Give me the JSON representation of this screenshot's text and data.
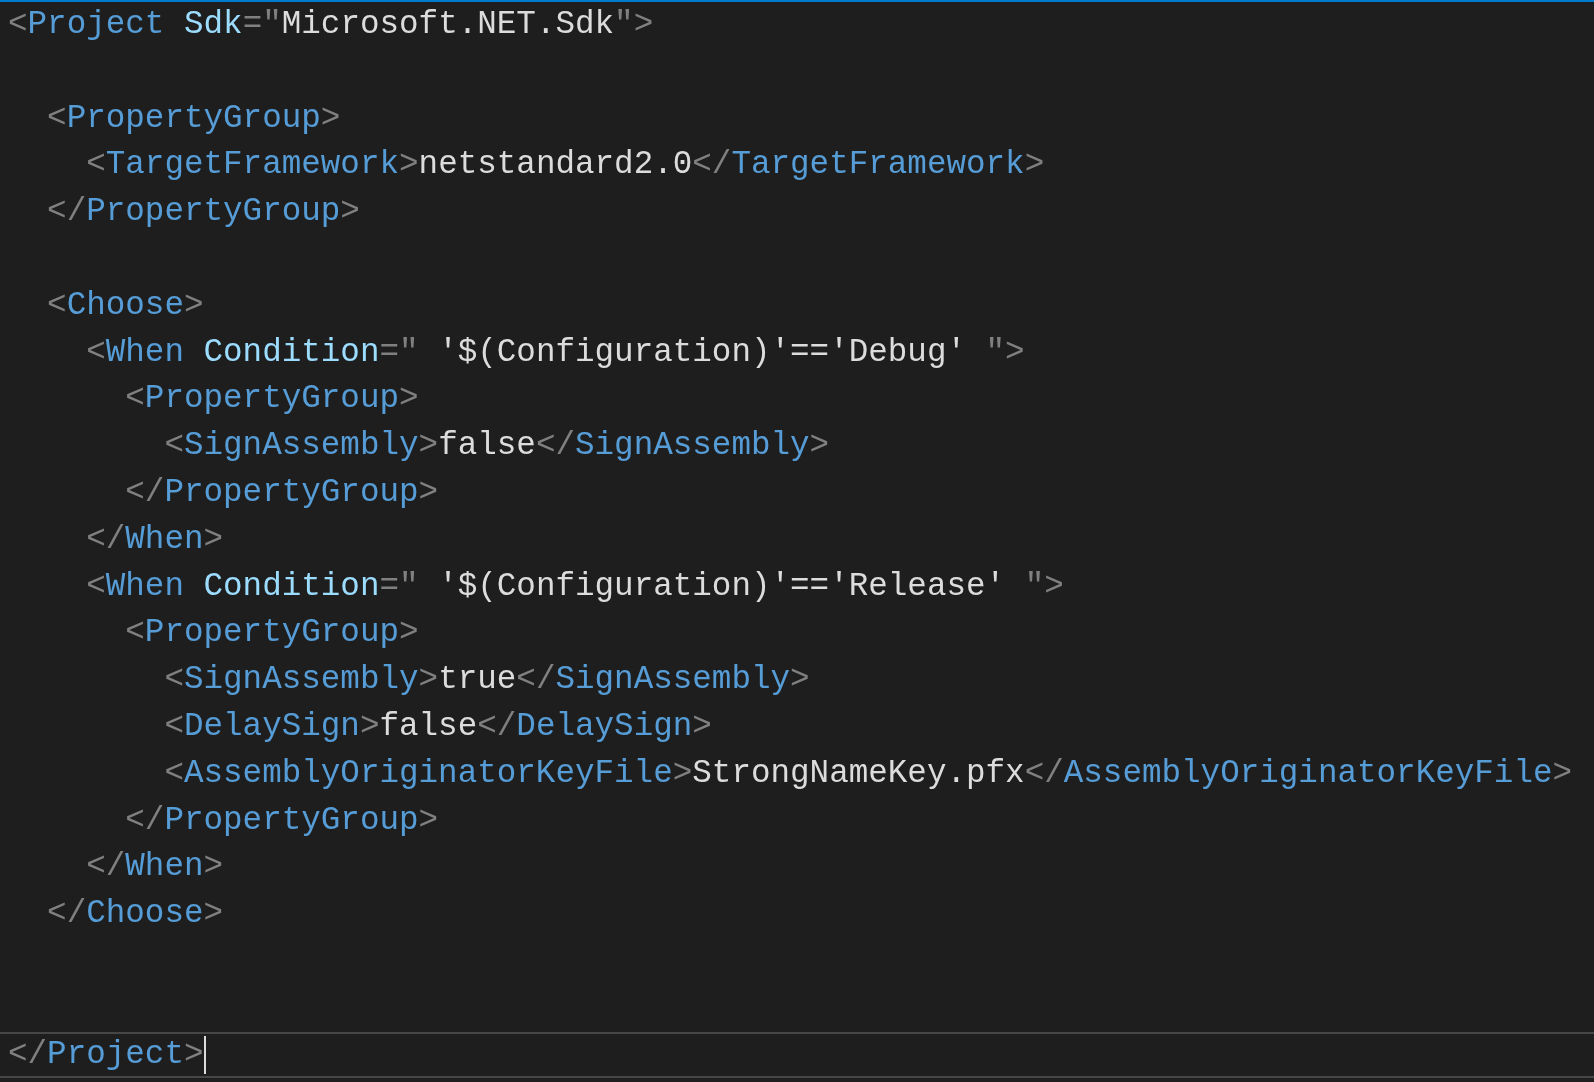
{
  "editor": {
    "lines": [
      {
        "kind": "code",
        "current": false,
        "tokens": [
          {
            "kind": "punct",
            "text": "<"
          },
          {
            "kind": "tag",
            "text": "Project"
          },
          {
            "kind": "attr",
            "text": " Sdk"
          },
          {
            "kind": "punct",
            "text": "=\""
          },
          {
            "kind": "value",
            "text": "Microsoft.NET.Sdk"
          },
          {
            "kind": "punct",
            "text": "\">"
          }
        ]
      },
      {
        "kind": "blank"
      },
      {
        "kind": "code",
        "current": false,
        "tokens": [
          {
            "kind": "punct",
            "text": "  <"
          },
          {
            "kind": "tag",
            "text": "PropertyGroup"
          },
          {
            "kind": "punct",
            "text": ">"
          }
        ]
      },
      {
        "kind": "code",
        "current": false,
        "tokens": [
          {
            "kind": "punct",
            "text": "    <"
          },
          {
            "kind": "tag",
            "text": "TargetFramework"
          },
          {
            "kind": "punct",
            "text": ">"
          },
          {
            "kind": "text",
            "text": "netstandard2.0"
          },
          {
            "kind": "punct",
            "text": "</"
          },
          {
            "kind": "tag",
            "text": "TargetFramework"
          },
          {
            "kind": "punct",
            "text": ">"
          }
        ]
      },
      {
        "kind": "code",
        "current": false,
        "tokens": [
          {
            "kind": "punct",
            "text": "  </"
          },
          {
            "kind": "tag",
            "text": "PropertyGroup"
          },
          {
            "kind": "punct",
            "text": ">"
          }
        ]
      },
      {
        "kind": "blank"
      },
      {
        "kind": "code",
        "current": false,
        "tokens": [
          {
            "kind": "punct",
            "text": "  <"
          },
          {
            "kind": "tag",
            "text": "Choose"
          },
          {
            "kind": "punct",
            "text": ">"
          }
        ]
      },
      {
        "kind": "code",
        "current": false,
        "tokens": [
          {
            "kind": "punct",
            "text": "    <"
          },
          {
            "kind": "tag",
            "text": "When"
          },
          {
            "kind": "attr",
            "text": " Condition"
          },
          {
            "kind": "punct",
            "text": "=\""
          },
          {
            "kind": "value",
            "text": " '$(Configuration)'=='Debug' "
          },
          {
            "kind": "punct",
            "text": "\">"
          }
        ]
      },
      {
        "kind": "code",
        "current": false,
        "tokens": [
          {
            "kind": "punct",
            "text": "      <"
          },
          {
            "kind": "tag",
            "text": "PropertyGroup"
          },
          {
            "kind": "punct",
            "text": ">"
          }
        ]
      },
      {
        "kind": "code",
        "current": false,
        "tokens": [
          {
            "kind": "punct",
            "text": "        <"
          },
          {
            "kind": "tag",
            "text": "SignAssembly"
          },
          {
            "kind": "punct",
            "text": ">"
          },
          {
            "kind": "text",
            "text": "false"
          },
          {
            "kind": "punct",
            "text": "</"
          },
          {
            "kind": "tag",
            "text": "SignAssembly"
          },
          {
            "kind": "punct",
            "text": ">"
          }
        ]
      },
      {
        "kind": "code",
        "current": false,
        "tokens": [
          {
            "kind": "punct",
            "text": "      </"
          },
          {
            "kind": "tag",
            "text": "PropertyGroup"
          },
          {
            "kind": "punct",
            "text": ">"
          }
        ]
      },
      {
        "kind": "code",
        "current": false,
        "tokens": [
          {
            "kind": "punct",
            "text": "    </"
          },
          {
            "kind": "tag",
            "text": "When"
          },
          {
            "kind": "punct",
            "text": ">"
          }
        ]
      },
      {
        "kind": "code",
        "current": false,
        "tokens": [
          {
            "kind": "punct",
            "text": "    <"
          },
          {
            "kind": "tag",
            "text": "When"
          },
          {
            "kind": "attr",
            "text": " Condition"
          },
          {
            "kind": "punct",
            "text": "=\""
          },
          {
            "kind": "value",
            "text": " '$(Configuration)'=='Release' "
          },
          {
            "kind": "punct",
            "text": "\">"
          }
        ]
      },
      {
        "kind": "code",
        "current": false,
        "tokens": [
          {
            "kind": "punct",
            "text": "      <"
          },
          {
            "kind": "tag",
            "text": "PropertyGroup"
          },
          {
            "kind": "punct",
            "text": ">"
          }
        ]
      },
      {
        "kind": "code",
        "current": false,
        "tokens": [
          {
            "kind": "punct",
            "text": "        <"
          },
          {
            "kind": "tag",
            "text": "SignAssembly"
          },
          {
            "kind": "punct",
            "text": ">"
          },
          {
            "kind": "text",
            "text": "true"
          },
          {
            "kind": "punct",
            "text": "</"
          },
          {
            "kind": "tag",
            "text": "SignAssembly"
          },
          {
            "kind": "punct",
            "text": ">"
          }
        ]
      },
      {
        "kind": "code",
        "current": false,
        "tokens": [
          {
            "kind": "punct",
            "text": "        <"
          },
          {
            "kind": "tag",
            "text": "DelaySign"
          },
          {
            "kind": "punct",
            "text": ">"
          },
          {
            "kind": "text",
            "text": "false"
          },
          {
            "kind": "punct",
            "text": "</"
          },
          {
            "kind": "tag",
            "text": "DelaySign"
          },
          {
            "kind": "punct",
            "text": ">"
          }
        ]
      },
      {
        "kind": "code",
        "current": false,
        "tokens": [
          {
            "kind": "punct",
            "text": "        <"
          },
          {
            "kind": "tag",
            "text": "AssemblyOriginatorKeyFile"
          },
          {
            "kind": "punct",
            "text": ">"
          },
          {
            "kind": "text",
            "text": "StrongNameKey.pfx"
          },
          {
            "kind": "punct",
            "text": "</"
          },
          {
            "kind": "tag",
            "text": "AssemblyOriginatorKeyFile"
          },
          {
            "kind": "punct",
            "text": ">"
          }
        ]
      },
      {
        "kind": "code",
        "current": false,
        "tokens": [
          {
            "kind": "punct",
            "text": "      </"
          },
          {
            "kind": "tag",
            "text": "PropertyGroup"
          },
          {
            "kind": "punct",
            "text": ">"
          }
        ]
      },
      {
        "kind": "code",
        "current": false,
        "tokens": [
          {
            "kind": "punct",
            "text": "    </"
          },
          {
            "kind": "tag",
            "text": "When"
          },
          {
            "kind": "punct",
            "text": ">"
          }
        ]
      },
      {
        "kind": "code",
        "current": false,
        "tokens": [
          {
            "kind": "punct",
            "text": "  </"
          },
          {
            "kind": "tag",
            "text": "Choose"
          },
          {
            "kind": "punct",
            "text": ">"
          }
        ]
      },
      {
        "kind": "blank"
      },
      {
        "kind": "blank"
      },
      {
        "kind": "code",
        "current": true,
        "tokens": [
          {
            "kind": "punct",
            "text": "</"
          },
          {
            "kind": "tag",
            "text": "Project"
          },
          {
            "kind": "punct",
            "text": ">"
          }
        ]
      }
    ]
  }
}
